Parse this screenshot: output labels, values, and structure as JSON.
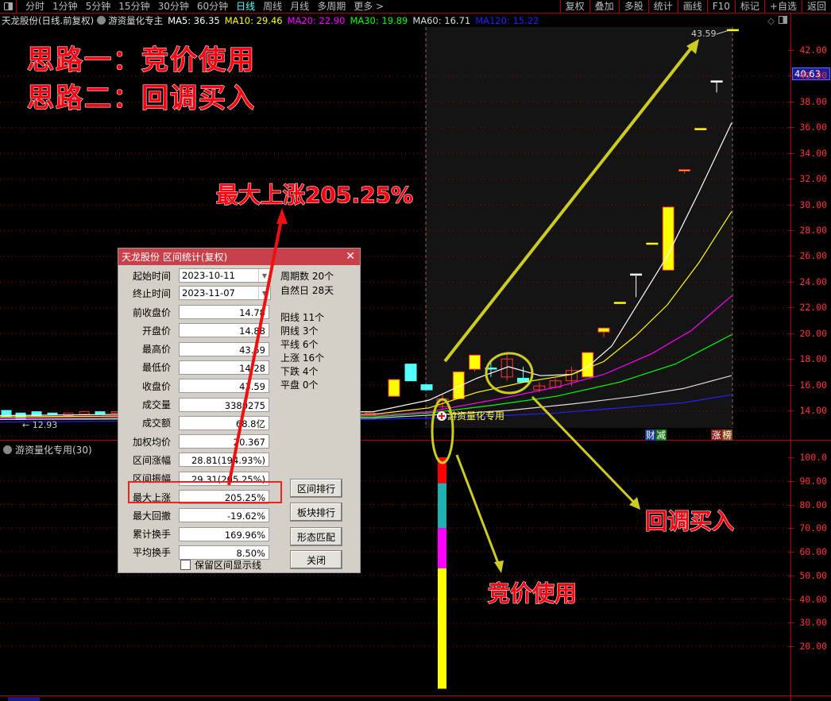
{
  "toolbar": {
    "periods": [
      {
        "label": "分时",
        "active": false
      },
      {
        "label": "1分钟",
        "active": false
      },
      {
        "label": "5分钟",
        "active": false
      },
      {
        "label": "15分钟",
        "active": false
      },
      {
        "label": "30分钟",
        "active": false
      },
      {
        "label": "60分钟",
        "active": false
      },
      {
        "label": "日线",
        "active": true
      },
      {
        "label": "周线",
        "active": false
      },
      {
        "label": "月线",
        "active": false
      },
      {
        "label": "多周期",
        "active": false
      },
      {
        "label": "更多 >",
        "active": false
      }
    ],
    "right_tools": [
      "复权",
      "叠加",
      "多股",
      "统计",
      "画线",
      "F10",
      "标记",
      "+自选",
      "返回"
    ]
  },
  "infobar": {
    "stock": "天龙股份(日线.前复权)",
    "indicator": "游资量化专主",
    "ma": [
      {
        "label": "MA5: 36.35",
        "color": "#ffffff"
      },
      {
        "label": "MA10: 29.46",
        "color": "#ffff00"
      },
      {
        "label": "MA20: 22.90",
        "color": "#ff00ff"
      },
      {
        "label": "MA30: 19.89",
        "color": "#00ff00"
      },
      {
        "label": "MA60: 16.71",
        "color": "#dddddd"
      },
      {
        "label": "MA120: 15.22",
        "color": "#2222ff"
      }
    ]
  },
  "axis": {
    "current_price": "40.63",
    "main_ticks": [
      "42.00",
      "40.00",
      "38.00",
      "36.00",
      "34.00",
      "32.00",
      "30.00",
      "28.00",
      "26.00",
      "24.00",
      "22.00",
      "20.00",
      "18.00",
      "16.00",
      "14.00"
    ],
    "sub_ticks": [
      "100.0",
      "90.00",
      "80.00",
      "70.00",
      "60.00",
      "50.00",
      "40.00",
      "30.00",
      "20.00"
    ]
  },
  "chart": {
    "high_label": "43.59",
    "low_label": "12.93",
    "indicator_tag": "游资量化专用",
    "flags": [
      {
        "chars": [
          "财",
          "减"
        ],
        "colors": [
          "#1a3a8a",
          "#1a7a1a"
        ]
      },
      {
        "chars": [
          "涨",
          "榜"
        ],
        "colors": [
          "#8a1a1a",
          "#8a4a1a"
        ]
      }
    ]
  },
  "chart_data": {
    "type": "candlestick",
    "title": "天龙股份(日线.前复权)",
    "ylim": [
      12.5,
      43.6
    ],
    "candles": [
      {
        "o": 14.3,
        "c": 14.9,
        "h": 15.3,
        "l": 14.1,
        "color": "red-hollow"
      },
      {
        "o": 14.9,
        "c": 17.0,
        "h": 17.0,
        "l": 14.9,
        "color": "yellow"
      },
      {
        "o": 17.2,
        "c": 18.3,
        "h": 18.3,
        "l": 17.0,
        "color": "yellow"
      },
      {
        "o": 17.3,
        "c": 17.3,
        "h": 17.8,
        "l": 16.6,
        "color": "cyan-doji"
      },
      {
        "o": 16.6,
        "c": 18.0,
        "h": 18.5,
        "l": 16.3,
        "color": "red-hollow"
      },
      {
        "o": 16.5,
        "c": 16.2,
        "h": 17.4,
        "l": 16.2,
        "color": "cyan"
      },
      {
        "o": 15.6,
        "c": 15.9,
        "h": 16.2,
        "l": 15.4,
        "color": "red-hollow"
      },
      {
        "o": 15.8,
        "c": 16.3,
        "h": 16.5,
        "l": 15.7,
        "color": "red-hollow"
      },
      {
        "o": 16.3,
        "c": 17.1,
        "h": 17.4,
        "l": 15.9,
        "color": "red-hollow"
      },
      {
        "o": 16.6,
        "c": 18.5,
        "h": 18.5,
        "l": 16.6,
        "color": "yellow"
      },
      {
        "o": 20.1,
        "c": 20.4,
        "h": 20.4,
        "l": 19.7,
        "color": "yellow"
      },
      {
        "o": 22.4,
        "c": 22.4,
        "h": 22.4,
        "l": 22.4,
        "color": "yellow-flat"
      },
      {
        "o": 24.6,
        "c": 24.6,
        "h": 24.6,
        "l": 22.8,
        "color": "white-T"
      },
      {
        "o": 27.0,
        "c": 27.0,
        "h": 27.0,
        "l": 27.0,
        "color": "yellow-flat"
      },
      {
        "o": 24.9,
        "c": 29.8,
        "h": 29.8,
        "l": 24.9,
        "color": "yellow"
      },
      {
        "o": 32.6,
        "c": 32.7,
        "h": 32.7,
        "l": 32.4,
        "color": "yellow"
      },
      {
        "o": 35.9,
        "c": 35.9,
        "h": 35.9,
        "l": 35.9,
        "color": "yellow-flat"
      },
      {
        "o": 39.6,
        "c": 39.6,
        "h": 39.6,
        "l": 38.7,
        "color": "white-T"
      },
      {
        "o": 43.59,
        "c": 43.59,
        "h": 43.59,
        "l": 43.59,
        "color": "yellow-flat"
      }
    ],
    "ma_series": [
      {
        "name": "MA5",
        "color": "#ffffff",
        "end": 36.35
      },
      {
        "name": "MA10",
        "color": "#ffff00",
        "end": 29.46
      },
      {
        "name": "MA20",
        "color": "#ff00ff",
        "end": 22.9
      },
      {
        "name": "MA30",
        "color": "#00ff00",
        "end": 19.89
      },
      {
        "name": "MA60",
        "color": "#dddddd",
        "end": 16.71
      },
      {
        "name": "MA120",
        "color": "#2222ff",
        "end": 15.22
      }
    ],
    "sub_indicator": {
      "name": "游资量化专用(30)",
      "ylim": [
        0,
        100
      ],
      "segments": [
        {
          "from": 89,
          "to": 100,
          "color": "#ff0000"
        },
        {
          "from": 70,
          "to": 89,
          "color": "#20b2b2"
        },
        {
          "from": 53,
          "to": 70,
          "color": "#ff00ff"
        },
        {
          "from": 2,
          "to": 53,
          "color": "#ffff00"
        }
      ]
    }
  },
  "dialog": {
    "title": "天龙股份 区间统计(复权)",
    "start_label": "起始时间",
    "start_value": "2023-10-11",
    "end_label": "终止时间",
    "end_value": "2023-11-07",
    "rows": [
      {
        "label": "前收盘价",
        "value": "14.78"
      },
      {
        "label": "开盘价",
        "value": "14.88"
      },
      {
        "label": "最高价",
        "value": "43.59"
      },
      {
        "label": "最低价",
        "value": "14.28"
      },
      {
        "label": "收盘价",
        "value": "43.59"
      },
      {
        "label": "成交量",
        "value": "3380275"
      },
      {
        "label": "成交额",
        "value": "68.8亿"
      },
      {
        "label": "加权均价",
        "value": "20.367"
      },
      {
        "label": "区间涨幅",
        "value": "28.81(194.93%)"
      },
      {
        "label": "区间振幅",
        "value": "29.31(205.25%)"
      },
      {
        "label": "最大上涨",
        "value": "205.25%"
      },
      {
        "label": "最大回撤",
        "value": "-19.62%"
      },
      {
        "label": "累计换手",
        "value": "169.96%"
      },
      {
        "label": "平均换手",
        "value": "8.50%"
      }
    ],
    "stats": [
      "周期数 20个",
      "自然日 28天",
      "阳线 11个",
      "阴线 3个",
      "平线 6个",
      "上涨 16个",
      "下跌 4个",
      "平盘 0个"
    ],
    "buttons": [
      "区间排行",
      "板块排行",
      "形态匹配",
      "关闭"
    ],
    "checkbox_label": "保留区间显示线",
    "checkbox_checked": false
  },
  "annotations": {
    "idea1": "思路一：竞价使用",
    "idea2": "思路二：回调买入",
    "max_rise": "最大上涨205.25%",
    "pullback": "回调买入",
    "auction": "竞价使用"
  }
}
